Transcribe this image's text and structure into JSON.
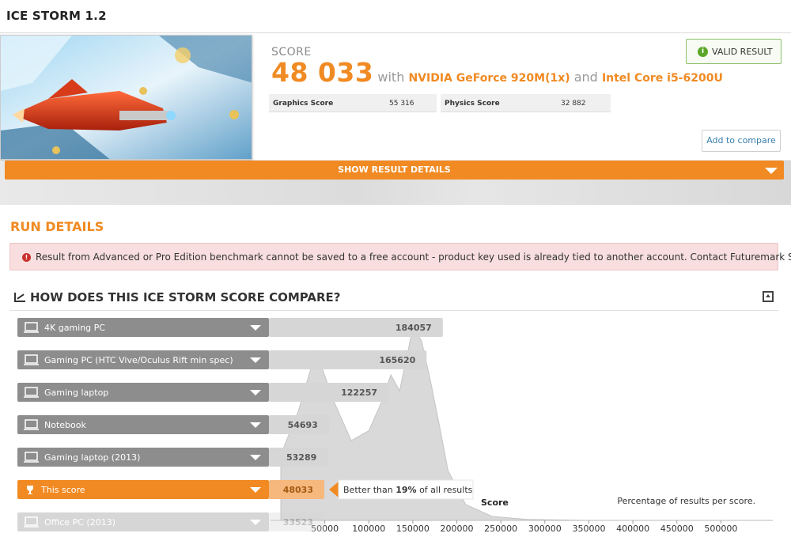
{
  "header": {
    "title": "ICE STORM 1.2"
  },
  "result": {
    "score_label": "SCORE",
    "score": "48 033",
    "with_word": "with",
    "gpu": "NVIDIA GeForce 920M(1x)",
    "and_word": "and",
    "cpu": "Intel Core i5-6200U",
    "subscores": [
      {
        "label": "Graphics Score",
        "value": "55 316"
      },
      {
        "label": "Physics Score",
        "value": "32 882"
      }
    ],
    "valid_label": "VALID RESULT",
    "add_compare_label": "Add to compare",
    "show_details_label": "SHOW RESULT DETAILS"
  },
  "run_details": {
    "title": "RUN DETAILS",
    "alert": "Result from Advanced or Pro Edition benchmark cannot be saved to a free account - product key used is already tied to another account. Contact Futuremark Support."
  },
  "compare": {
    "title": "HOW DOES THIS ICE STORM SCORE COMPARE?",
    "better_than_prefix": "Better than ",
    "better_than_pct": "19%",
    "better_than_suffix": " of all results",
    "rows": [
      {
        "label": "4K gaming PC",
        "value": 184057
      },
      {
        "label": "Gaming PC (HTC Vive/Oculus Rift min spec)",
        "value": 165620
      },
      {
        "label": "Gaming laptop",
        "value": 122257
      },
      {
        "label": "Notebook",
        "value": 54693
      },
      {
        "label": "Gaming laptop (2013)",
        "value": 53289
      },
      {
        "label": "This score",
        "value": 48033,
        "highlight": true
      },
      {
        "label": "Office PC (2013)",
        "value": 33523,
        "faded": true
      }
    ],
    "colors": {
      "accent": "#f18a22",
      "row_bar": "#8d8d8d",
      "value_box": "#d6d6d6",
      "density": "#d9d9d9"
    }
  },
  "chart_data": {
    "type": "area",
    "xlabel": "Score",
    "annotation": "Percentage of results per score.",
    "x_ticks": [
      50000,
      100000,
      150000,
      200000,
      250000,
      300000,
      350000,
      400000,
      450000,
      500000
    ],
    "xlim": [
      0,
      550000
    ],
    "distribution": {
      "x": [
        0,
        20000,
        40000,
        60000,
        80000,
        100000,
        115000,
        125000,
        135000,
        145000,
        150000,
        160000,
        170000,
        180000,
        190000,
        210000,
        240000,
        280000,
        350000,
        450000,
        550000
      ],
      "y": [
        0.33,
        0.55,
        0.85,
        0.6,
        0.4,
        0.45,
        0.6,
        0.73,
        0.65,
        0.86,
        0.97,
        0.9,
        0.7,
        0.48,
        0.25,
        0.08,
        0.02,
        0.005,
        0,
        0,
        0
      ]
    }
  }
}
